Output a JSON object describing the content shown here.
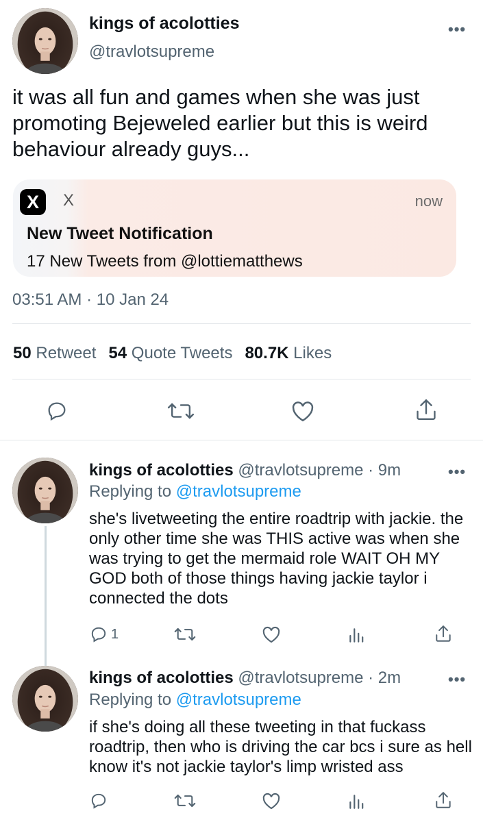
{
  "main_tweet": {
    "display_name": "kings of acolotties",
    "handle": "@travlotsupreme",
    "more_label": "•••",
    "text": "it was all fun and games when she was just promoting Bejeweled earlier but this is weird behaviour already guys...",
    "timestamp": "03:51 AM · 10 Jan 24",
    "stats": {
      "retweets_count": "50",
      "retweets_label": "Retweet",
      "quotes_count": "54",
      "quotes_label": "Quote Tweets",
      "likes_count": "80.7K",
      "likes_label": "Likes"
    },
    "actions": [
      "reply-icon",
      "retweet-icon",
      "like-icon",
      "share-icon"
    ]
  },
  "notification_card": {
    "app_logo": "X",
    "app_name": "X",
    "time": "now",
    "title": "New Tweet Notification",
    "body": "17 New Tweets from @lottiematthews",
    "background_color": "#fbe9e3"
  },
  "replies": [
    {
      "display_name": "kings of acolotties",
      "handle": "@travlotsupreme",
      "time": "· 9m",
      "replying_prefix": "Replying to",
      "replying_to": "@travlotsupreme",
      "text": "she's livetweeting the entire roadtrip with jackie. the only other time she was THIS active was when she was trying to get the mermaid role WAIT OH MY GOD both of those things having jackie taylor i connected the dots",
      "reply_count": "1",
      "more_label": "•••"
    },
    {
      "display_name": "kings of acolotties",
      "handle": "@travlotsupreme",
      "time": "· 2m",
      "replying_prefix": "Replying to",
      "replying_to": "@travlotsupreme",
      "text": "if she's doing all these tweeting in that fuckass roadtrip, then who is driving the car bcs i sure as hell know it's not jackie taylor's limp wristed ass",
      "reply_count": "",
      "more_label": "•••"
    }
  ],
  "colors": {
    "link": "#1d9bf0",
    "secondary_text": "#536471",
    "thread_line": "#cfd9de"
  }
}
